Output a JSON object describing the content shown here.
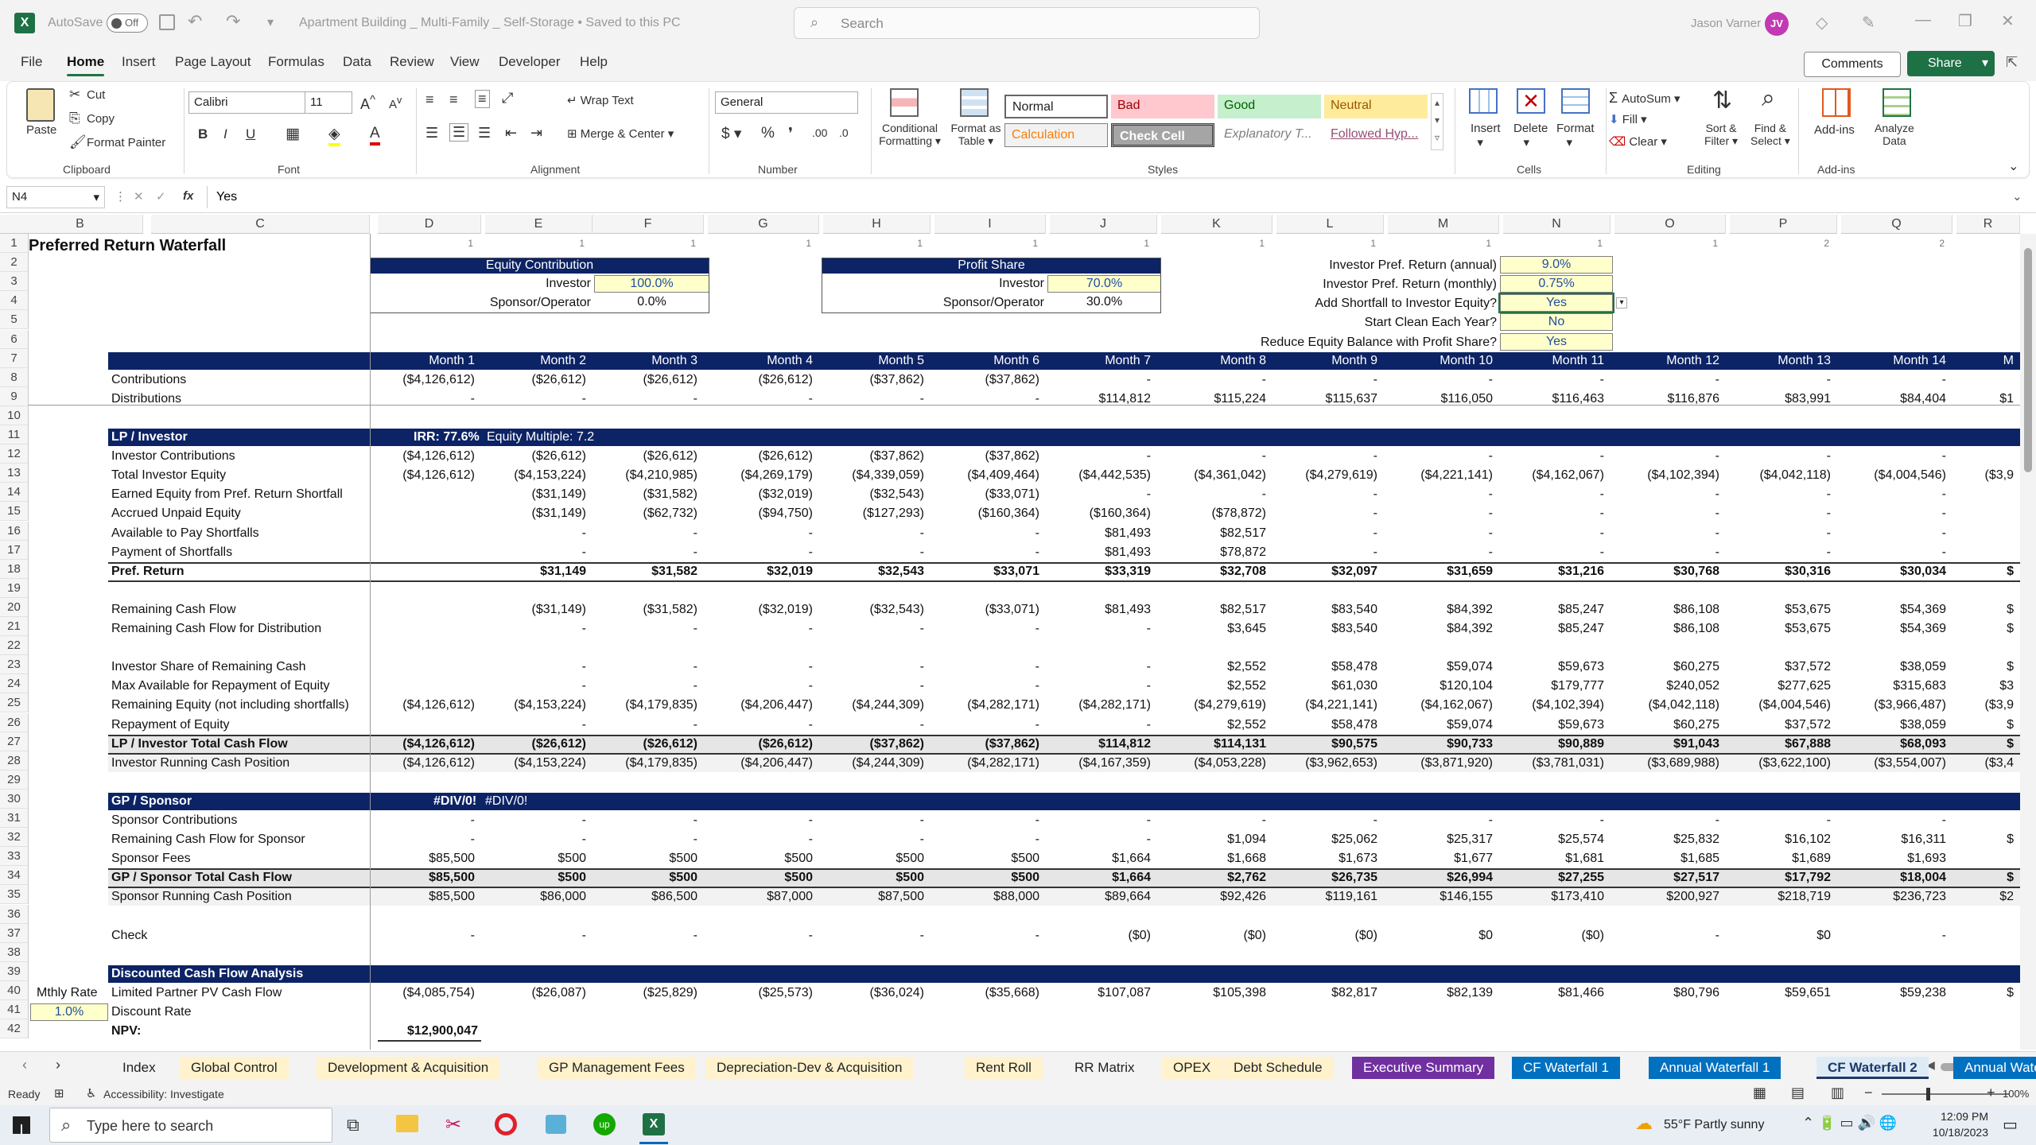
{
  "titlebar": {
    "autosave": "AutoSave",
    "autosave_state": "Off",
    "filename": "Apartment Building _ Multi-Family _ Self-Storage • Saved to this PC",
    "search_placeholder": "Search",
    "user": "Jason Varner",
    "initials": "JV"
  },
  "menu": [
    "File",
    "Home",
    "Insert",
    "Page Layout",
    "Formulas",
    "Data",
    "Review",
    "View",
    "Developer",
    "Help"
  ],
  "comments_label": "Comments",
  "share_label": "Share",
  "ribbon": {
    "clipboard": {
      "paste": "Paste",
      "cut": "Cut",
      "copy": "Copy",
      "format_painter": "Format Painter",
      "group": "Clipboard"
    },
    "font": {
      "name": "Calibri",
      "size": "11",
      "group": "Font"
    },
    "alignment": {
      "wrap": "Wrap Text",
      "merge": "Merge & Center",
      "group": "Alignment"
    },
    "number": {
      "format": "General",
      "group": "Number"
    },
    "styles": {
      "conditional": "Conditional",
      "conditional2": "Formatting",
      "format_as": "Format as",
      "table": "Table",
      "normal": "Normal",
      "bad": "Bad",
      "good": "Good",
      "neutral": "Neutral",
      "calculation": "Calculation",
      "check_cell": "Check Cell",
      "explanatory": "Explanatory T...",
      "followed": "Followed Hyp...",
      "group": "Styles"
    },
    "cells": {
      "insert": "Insert",
      "delete": "Delete",
      "format": "Format",
      "group": "Cells"
    },
    "editing": {
      "autosum": "AutoSum",
      "fill": "Fill",
      "clear": "Clear",
      "sort": "Sort &",
      "filter": "Filter",
      "find": "Find &",
      "select": "Select",
      "group": "Editing"
    },
    "addins": {
      "addins": "Add-ins",
      "analyze": "Analyze",
      "data": "Data",
      "group": "Add-ins"
    }
  },
  "formula_bar": {
    "name_box": "N4",
    "fx": "fx",
    "value": "Yes"
  },
  "columns": [
    [
      "A",
      38,
      100
    ],
    [
      "B",
      22,
      180
    ],
    [
      "C",
      190,
      465
    ],
    [
      "D",
      475,
      605
    ],
    [
      "E",
      610,
      745
    ],
    [
      "F",
      745,
      885
    ],
    [
      "G",
      890,
      1030
    ],
    [
      "H",
      1035,
      1170
    ],
    [
      "I",
      1175,
      1315
    ],
    [
      "J",
      1320,
      1455
    ],
    [
      "K",
      1460,
      1600
    ],
    [
      "L",
      1605,
      1740
    ],
    [
      "M",
      1745,
      1885
    ],
    [
      "N",
      1890,
      2025
    ],
    [
      "O",
      2030,
      2170
    ],
    [
      "P",
      2175,
      2310
    ],
    [
      "Q",
      2315,
      2455
    ],
    [
      "R",
      2460,
      2540
    ]
  ],
  "row1_markers": [
    "1",
    "1",
    "1",
    "1",
    "1",
    "1",
    "1",
    "1",
    "1",
    "1",
    "1",
    "1",
    "2",
    "2"
  ],
  "title": "Preferred Return Waterfall",
  "equity": {
    "header": "Equity Contribution",
    "investor_label": "Investor",
    "investor_val": "100.0%",
    "sponsor_label": "Sponsor/Operator",
    "sponsor_val": "0.0%"
  },
  "profit": {
    "header": "Profit Share",
    "investor_label": "Investor",
    "investor_val": "70.0%",
    "sponsor_label": "Sponsor/Operator",
    "sponsor_val": "30.0%"
  },
  "params": [
    [
      "Investor Pref. Return (annual)",
      "9.0%"
    ],
    [
      "Investor Pref. Return (monthly)",
      "0.75%"
    ],
    [
      "Add Shortfall to Investor Equity?",
      "Yes"
    ],
    [
      "Start Clean Each Year?",
      "No"
    ],
    [
      "Reduce Equity Balance with Profit Share?",
      "Yes"
    ]
  ],
  "months": [
    "Month 1",
    "Month 2",
    "Month 3",
    "Month 4",
    "Month 5",
    "Month 6",
    "Month 7",
    "Month 8",
    "Month 9",
    "Month 10",
    "Month 11",
    "Month 12",
    "Month 13",
    "Month 14",
    "M"
  ],
  "rows": [
    {
      "r": 8,
      "label": "Contributions",
      "v": [
        "($4,126,612)",
        "($26,612)",
        "($26,612)",
        "($26,612)",
        "($37,862)",
        "($37,862)",
        "-",
        "-",
        "-",
        "-",
        "-",
        "-",
        "-",
        "-",
        ""
      ]
    },
    {
      "r": 9,
      "label": "Distributions",
      "v": [
        "-",
        "-",
        "-",
        "-",
        "-",
        "-",
        "$114,812",
        "$115,224",
        "$115,637",
        "$116,050",
        "$116,463",
        "$116,876",
        "$83,991",
        "$84,404",
        "$1"
      ]
    },
    {
      "r": 12,
      "label": "Investor Contributions",
      "v": [
        "($4,126,612)",
        "($26,612)",
        "($26,612)",
        "($26,612)",
        "($37,862)",
        "($37,862)",
        "-",
        "-",
        "-",
        "-",
        "-",
        "-",
        "-",
        "-",
        ""
      ]
    },
    {
      "r": 13,
      "label": "Total Investor Equity",
      "v": [
        "($4,126,612)",
        "($4,153,224)",
        "($4,210,985)",
        "($4,269,179)",
        "($4,339,059)",
        "($4,409,464)",
        "($4,442,535)",
        "($4,361,042)",
        "($4,279,619)",
        "($4,221,141)",
        "($4,162,067)",
        "($4,102,394)",
        "($4,042,118)",
        "($4,004,546)",
        "($3,9"
      ]
    },
    {
      "r": 14,
      "label": "Earned Equity from Pref. Return Shortfall",
      "v": [
        "",
        "($31,149)",
        "($31,582)",
        "($32,019)",
        "($32,543)",
        "($33,071)",
        "-",
        "-",
        "-",
        "-",
        "-",
        "-",
        "-",
        "-",
        ""
      ]
    },
    {
      "r": 15,
      "label": "Accrued Unpaid Equity",
      "v": [
        "",
        "($31,149)",
        "($62,732)",
        "($94,750)",
        "($127,293)",
        "($160,364)",
        "($160,364)",
        "($78,872)",
        "-",
        "-",
        "-",
        "-",
        "-",
        "-",
        ""
      ]
    },
    {
      "r": 16,
      "label": "Available to Pay Shortfalls",
      "v": [
        "",
        "-",
        "-",
        "-",
        "-",
        "-",
        "$81,493",
        "$82,517",
        "-",
        "-",
        "-",
        "-",
        "-",
        "-",
        ""
      ]
    },
    {
      "r": 17,
      "label": "Payment of Shortfalls",
      "v": [
        "",
        "-",
        "-",
        "-",
        "-",
        "-",
        "$81,493",
        "$78,872",
        "-",
        "-",
        "-",
        "-",
        "-",
        "-",
        ""
      ]
    },
    {
      "r": 18,
      "label": "Pref. Return",
      "bold": true,
      "v": [
        "",
        "$31,149",
        "$31,582",
        "$32,019",
        "$32,543",
        "$33,071",
        "$33,319",
        "$32,708",
        "$32,097",
        "$31,659",
        "$31,216",
        "$30,768",
        "$30,316",
        "$30,034",
        "$"
      ]
    },
    {
      "r": 20,
      "label": "Remaining Cash Flow",
      "v": [
        "",
        "($31,149)",
        "($31,582)",
        "($32,019)",
        "($32,543)",
        "($33,071)",
        "$81,493",
        "$82,517",
        "$83,540",
        "$84,392",
        "$85,247",
        "$86,108",
        "$53,675",
        "$54,369",
        "$"
      ]
    },
    {
      "r": 21,
      "label": "Remaining Cash Flow for Distribution",
      "v": [
        "",
        "-",
        "-",
        "-",
        "-",
        "-",
        "-",
        "$3,645",
        "$83,540",
        "$84,392",
        "$85,247",
        "$86,108",
        "$53,675",
        "$54,369",
        "$"
      ]
    },
    {
      "r": 23,
      "label": "Investor Share of Remaining Cash",
      "v": [
        "",
        "-",
        "-",
        "-",
        "-",
        "-",
        "-",
        "$2,552",
        "$58,478",
        "$59,074",
        "$59,673",
        "$60,275",
        "$37,572",
        "$38,059",
        "$"
      ]
    },
    {
      "r": 24,
      "label": "Max Available for Repayment of Equity",
      "v": [
        "",
        "-",
        "-",
        "-",
        "-",
        "-",
        "-",
        "$2,552",
        "$61,030",
        "$120,104",
        "$179,777",
        "$240,052",
        "$277,625",
        "$315,683",
        "$3"
      ]
    },
    {
      "r": 25,
      "label": "Remaining Equity (not including shortfalls)",
      "v": [
        "($4,126,612)",
        "($4,153,224)",
        "($4,179,835)",
        "($4,206,447)",
        "($4,244,309)",
        "($4,282,171)",
        "($4,282,171)",
        "($4,279,619)",
        "($4,221,141)",
        "($4,162,067)",
        "($4,102,394)",
        "($4,042,118)",
        "($4,004,546)",
        "($3,966,487)",
        "($3,9"
      ]
    },
    {
      "r": 26,
      "label": "Repayment of Equity",
      "v": [
        "",
        "-",
        "-",
        "-",
        "-",
        "-",
        "-",
        "$2,552",
        "$58,478",
        "$59,074",
        "$59,673",
        "$60,275",
        "$37,572",
        "$38,059",
        "$"
      ]
    },
    {
      "r": 27,
      "label": "LP / Investor Total Cash Flow",
      "bold": true,
      "v": [
        "($4,126,612)",
        "($26,612)",
        "($26,612)",
        "($26,612)",
        "($37,862)",
        "($37,862)",
        "$114,812",
        "$114,131",
        "$90,575",
        "$90,733",
        "$90,889",
        "$91,043",
        "$67,888",
        "$68,093",
        "$"
      ]
    },
    {
      "r": 28,
      "label": "Investor Running Cash Position",
      "v": [
        "($4,126,612)",
        "($4,153,224)",
        "($4,179,835)",
        "($4,206,447)",
        "($4,244,309)",
        "($4,282,171)",
        "($4,167,359)",
        "($4,053,228)",
        "($3,962,653)",
        "($3,871,920)",
        "($3,781,031)",
        "($3,689,988)",
        "($3,622,100)",
        "($3,554,007)",
        "($3,4"
      ]
    },
    {
      "r": 31,
      "label": "Sponsor Contributions",
      "v": [
        "-",
        "-",
        "-",
        "-",
        "-",
        "-",
        "-",
        "-",
        "-",
        "-",
        "-",
        "-",
        "-",
        "-",
        ""
      ]
    },
    {
      "r": 32,
      "label": "Remaining Cash Flow for Sponsor",
      "v": [
        "-",
        "-",
        "-",
        "-",
        "-",
        "-",
        "-",
        "$1,094",
        "$25,062",
        "$25,317",
        "$25,574",
        "$25,832",
        "$16,102",
        "$16,311",
        "$"
      ]
    },
    {
      "r": 33,
      "label": "Sponsor Fees",
      "v": [
        "$85,500",
        "$500",
        "$500",
        "$500",
        "$500",
        "$500",
        "$1,664",
        "$1,668",
        "$1,673",
        "$1,677",
        "$1,681",
        "$1,685",
        "$1,689",
        "$1,693",
        ""
      ]
    },
    {
      "r": 34,
      "label": "GP / Sponsor Total Cash Flow",
      "bold": true,
      "v": [
        "$85,500",
        "$500",
        "$500",
        "$500",
        "$500",
        "$500",
        "$1,664",
        "$2,762",
        "$26,735",
        "$26,994",
        "$27,255",
        "$27,517",
        "$17,792",
        "$18,004",
        "$"
      ]
    },
    {
      "r": 35,
      "label": "Sponsor Running Cash Position",
      "v": [
        "$85,500",
        "$86,000",
        "$86,500",
        "$87,000",
        "$87,500",
        "$88,000",
        "$89,664",
        "$92,426",
        "$119,161",
        "$146,155",
        "$173,410",
        "$200,927",
        "$218,719",
        "$236,723",
        "$2"
      ]
    },
    {
      "r": 37,
      "label": "Check",
      "v": [
        "-",
        "-",
        "-",
        "-",
        "-",
        "-",
        "($0)",
        "($0)",
        "($0)",
        "$0",
        "($0)",
        "-",
        "$0",
        "-",
        ""
      ]
    },
    {
      "r": 40,
      "label": "Limited Partner PV Cash Flow",
      "v": [
        "($4,085,754)",
        "($26,087)",
        "($25,829)",
        "($25,573)",
        "($36,024)",
        "($35,668)",
        "$107,087",
        "$105,398",
        "$82,817",
        "$82,139",
        "$81,466",
        "$80,796",
        "$59,651",
        "$59,238",
        "$"
      ]
    }
  ],
  "lp_header": "LP / Investor",
  "irr": "IRR: 77.6%",
  "eq_mult": "Equity Multiple: 7.2",
  "gp_header": "GP / Sponsor",
  "div1": "#DIV/0!",
  "div2": "#DIV/0!",
  "dcf_header": "Discounted Cash Flow Analysis",
  "mthly_rate_label": "Mthly Rate",
  "mthly_rate_val": "1.0%",
  "discount_rate": "Discount Rate",
  "npv_label": "NPV:",
  "npv_val": "$12,900,047",
  "sheet_tabs": [
    [
      "Index",
      "#f3f3f3",
      "#222"
    ],
    [
      "Global Control",
      "#fff2cc",
      "#222"
    ],
    [
      "Development & Acquisition",
      "#fff2cc",
      "#222"
    ],
    [
      "GP Management Fees",
      "#fff2cc",
      "#222"
    ],
    [
      "Depreciation-Dev & Acquisition",
      "#fff2cc",
      "#222"
    ],
    [
      "Rent Roll",
      "#fff2cc",
      "#222"
    ],
    [
      "RR Matrix",
      "#f3f3f3",
      "#222"
    ],
    [
      "OPEX",
      "#fff2cc",
      "#222"
    ],
    [
      "Debt Schedule",
      "#fff2cc",
      "#222"
    ],
    [
      "Executive Summary",
      "#7030a0",
      "#fff"
    ],
    [
      "CF Waterfall 1",
      "#0070c0",
      "#fff"
    ],
    [
      "Annual Waterfall 1",
      "#0070c0",
      "#fff"
    ],
    [
      "CF Waterfall 2",
      "#ddebf7",
      "#1f3864"
    ],
    [
      "Annual Water",
      "#0070c0",
      "#fff"
    ]
  ],
  "status": {
    "ready": "Ready",
    "accessibility": "Accessibility: Investigate",
    "zoom": "100%"
  },
  "taskbar": {
    "search_placeholder": "Type here to search",
    "weather": "55°F  Partly sunny",
    "time": "12:09 PM",
    "date": "10/18/2023"
  }
}
